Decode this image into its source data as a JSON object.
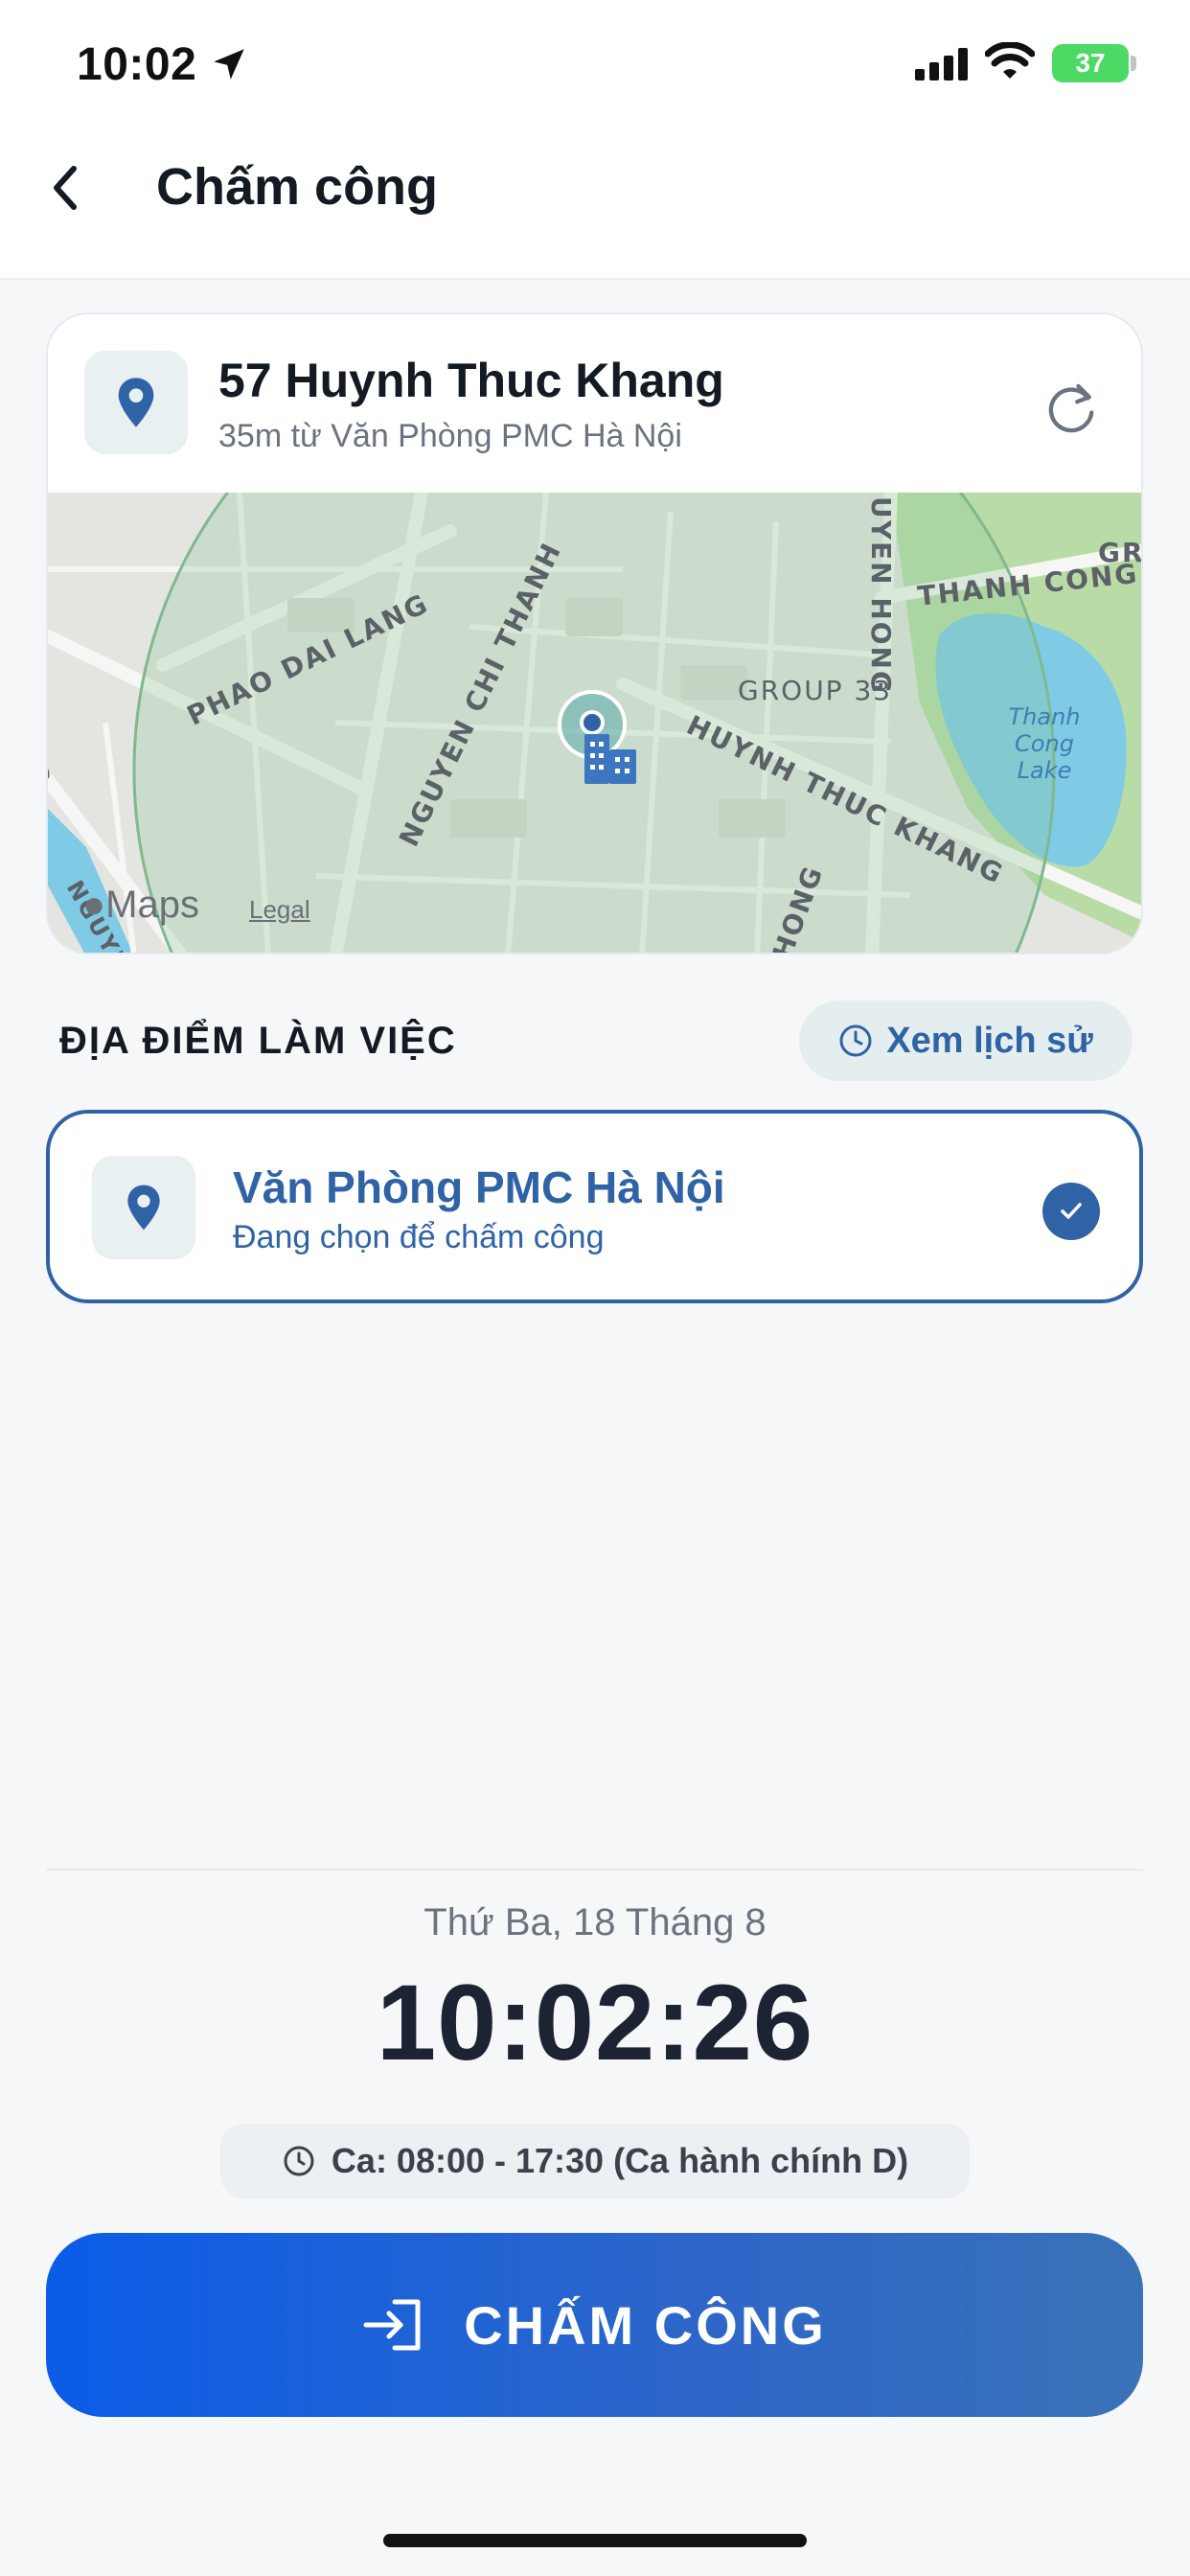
{
  "status_bar": {
    "time": "10:02",
    "battery": "37"
  },
  "header": {
    "title": "Chấm công"
  },
  "location": {
    "address": "57 Huynh Thuc Khang",
    "distance": "35m từ Văn Phòng PMC Hà Nội"
  },
  "map": {
    "labels": {
      "phao_dai_lang": "PHAO DAI LANG",
      "nguyen_chi_thanh": "NGUYEN CHI THANH",
      "huynh_thuc_khang": "HUYNH THUC KHANG",
      "group_33": "GROUP 33",
      "thanh_cong": "THANH CONG",
      "uyen_hong": "UYEN HONG",
      "gr": "GR",
      "hong": "HONG",
      "ang": "ANG",
      "nguye": "NGUYE"
    },
    "lake": "Thanh Cong Lake",
    "attribution": "Maps",
    "legal": "Legal"
  },
  "section": {
    "title": "ĐỊA ĐIỂM LÀM VIỆC",
    "history_button": "Xem lịch sử"
  },
  "office": {
    "name": "Văn Phòng PMC Hà Nội",
    "status": "Đang chọn để chấm công"
  },
  "clock": {
    "date": "Thứ Ba, 18 Tháng 8",
    "time": "10:02:26",
    "shift": "Ca: 08:00 - 17:30 (Ca hành chính D)"
  },
  "action": {
    "label": "CHẤM CÔNG"
  },
  "colors": {
    "accent": "#2f63a6",
    "button": "#0b5ce8",
    "battery": "#4cd964"
  }
}
